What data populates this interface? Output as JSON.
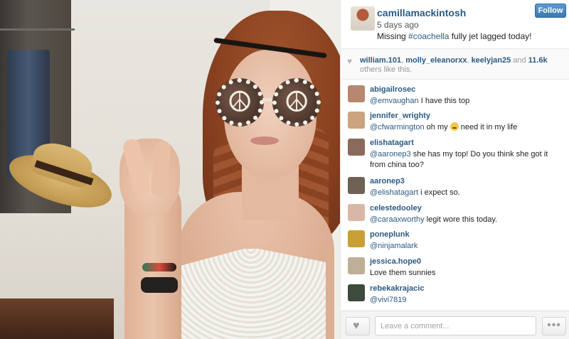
{
  "post": {
    "username": "camillamackintosh",
    "time_ago": "5 days ago",
    "caption_before": "Missing ",
    "caption_tag": "#coachella",
    "caption_after": " fully jet lagged today!",
    "follow_label": "Follow"
  },
  "likes": {
    "user1": "william.101",
    "user2": "molly_eleanorxx",
    "user3": "keelyjan25",
    "joiner": "and",
    "count": "11.6k",
    "suffix": "others like this."
  },
  "comments": [
    {
      "user": "abigailrosec",
      "mention": "@emvaughan",
      "text": " I have this top",
      "avatar_color": "#b88770"
    },
    {
      "user": "jennifer_wrighty",
      "mention": "@cfwarmington",
      "text_before": " oh my ",
      "emoji": "persevere-emoji",
      "text_after": " need it in my life",
      "avatar_color": "#c9a47e"
    },
    {
      "user": "elishatagart",
      "mention": "@aaronep3",
      "text": " she has my top! Do you think she got it from china too?",
      "avatar_color": "#8a6a5a"
    },
    {
      "user": "aaronep3",
      "mention": "@elishatagart",
      "text": " i expect so.",
      "avatar_color": "#6f6255"
    },
    {
      "user": "celestedooley",
      "mention": "@caraaxworthy",
      "text": " legit wore this today.",
      "avatar_color": "#d8b7a6"
    },
    {
      "user": "poneplunk",
      "mention": "@ninjamalark",
      "text": "",
      "avatar_color": "#c9a035"
    },
    {
      "user": "jessica.hope0",
      "mention": "",
      "text": "Love them sunnies",
      "avatar_color": "#bfae98"
    },
    {
      "user": "rebekakrajacic",
      "mention": "@vivi7819",
      "text": "",
      "avatar_color": "#3d4a3e"
    }
  ],
  "footer": {
    "comment_placeholder": "Leave a comment...",
    "more_label": "•••"
  },
  "colors": {
    "link": "#2b5b84",
    "follow_button": "#4a87c2"
  }
}
